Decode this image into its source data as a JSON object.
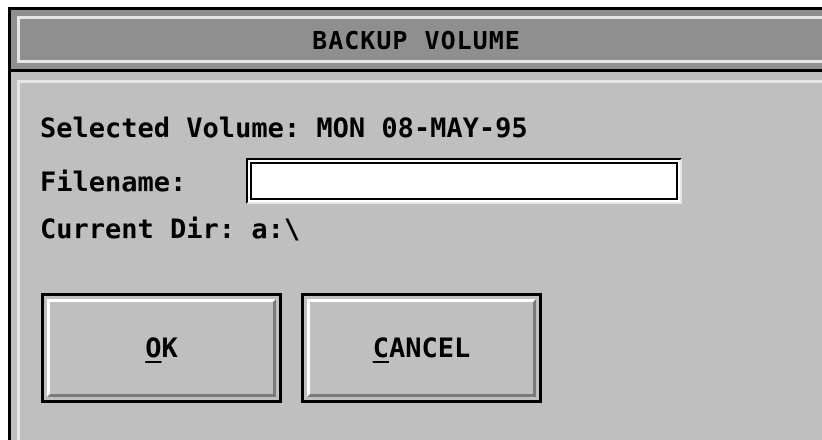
{
  "dialog": {
    "title": "BACKUP VOLUME"
  },
  "fields": {
    "selected_volume_label": "Selected Volume:",
    "selected_volume_value": "MON 08-MAY-95",
    "filename_label": "Filename:",
    "filename_value": "",
    "current_dir_label": "Current Dir:",
    "current_dir_value": "a:\\"
  },
  "buttons": {
    "ok": {
      "mnemonic": "O",
      "rest": "K"
    },
    "cancel": {
      "mnemonic": "C",
      "rest": "ANCEL"
    }
  }
}
